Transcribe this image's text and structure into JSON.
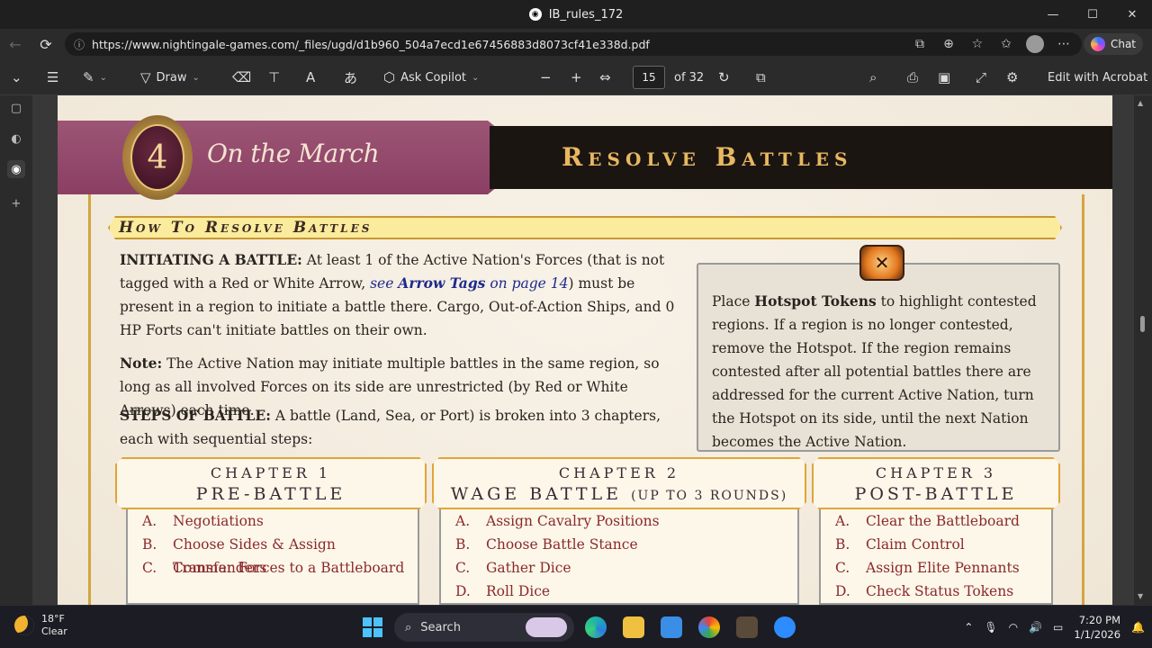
{
  "window": {
    "title": "IB_rules_172",
    "controls": {
      "minimize": "—",
      "maximize": "☐",
      "close": "✕"
    }
  },
  "address_bar": {
    "url": "https://www.nightingale-games.com/_files/ugd/d1b960_504a7ecd1e67456883d8073cf41e338d.pdf",
    "chat_label": "Chat"
  },
  "pdf_toolbar": {
    "draw_label": "Draw",
    "ask_copilot_label": "Ask Copilot",
    "page_number": "15",
    "page_total": "of 32",
    "edit_acrobat_label": "Edit with Acrobat"
  },
  "document": {
    "chapter_number": "4",
    "chapter_title": "On the March",
    "section_title": "Resolve Battles",
    "subsection_title": "How To Resolve Battles",
    "initiating_label": "INITIATING A BATTLE:",
    "initiating_text_1": " At least 1 of the Active Nation's Forces (that is not tagged with a Red or White Arrow, ",
    "initiating_link_pre": "see ",
    "initiating_link_bold": "Arrow Tags",
    "initiating_link_post": " on page 14",
    "initiating_text_2": ") must be present in a region to initiate a battle there.  Cargo, Out-of-Action Ships, and 0 HP Forts can't initiate battles on their own.",
    "note_label": "Note:",
    "note_text": " The Active Nation may initiate multiple battles in the same region, so long as all involved Forces on its side are unrestricted (by Red or White Arrows) each time.",
    "steps_label": "STEPS OF BATTLE:",
    "steps_text": "  A battle (Land, Sea, or Port) is broken into 3 chapters, each with sequential steps:",
    "hotspot_pre": "Place ",
    "hotspot_bold": "Hotspot Tokens",
    "hotspot_text": " to highlight contested regions.  If a region is no longer contested, remove the Hotspot.  If the region remains contested after all potential battles there are addressed for the current Active Nation, turn the Hotspot on its side, until the next Nation becomes the Active Nation.",
    "chapters": [
      {
        "number": "CHAPTER 1",
        "name": "PRE-BATTLE",
        "name_suffix": "",
        "steps": [
          {
            "letter": "A.",
            "text": "Negotiations"
          },
          {
            "letter": "B.",
            "text": "Choose Sides & Assign Commanders"
          },
          {
            "letter": "C.",
            "text": "Transfer Forces to a Battleboard"
          }
        ]
      },
      {
        "number": "CHAPTER 2",
        "name": "WAGE BATTLE",
        "name_suffix": "(UP TO 3 ROUNDS)",
        "steps": [
          {
            "letter": "A.",
            "text": "Assign Cavalry Positions"
          },
          {
            "letter": "B.",
            "text": "Choose Battle Stance"
          },
          {
            "letter": "C.",
            "text": "Gather Dice"
          },
          {
            "letter": "D.",
            "text": "Roll Dice"
          }
        ]
      },
      {
        "number": "CHAPTER 3",
        "name": "POST-BATTLE",
        "name_suffix": "",
        "steps": [
          {
            "letter": "A.",
            "text": "Clear the Battleboard"
          },
          {
            "letter": "B.",
            "text": "Claim Control"
          },
          {
            "letter": "C.",
            "text": "Assign Elite Pennants"
          },
          {
            "letter": "D.",
            "text": "Check Status Tokens"
          }
        ]
      }
    ]
  },
  "taskbar": {
    "temperature": "18°F",
    "condition": "Clear",
    "search_label": "Search",
    "time": "7:20 PM",
    "date": "1/1/2026"
  }
}
